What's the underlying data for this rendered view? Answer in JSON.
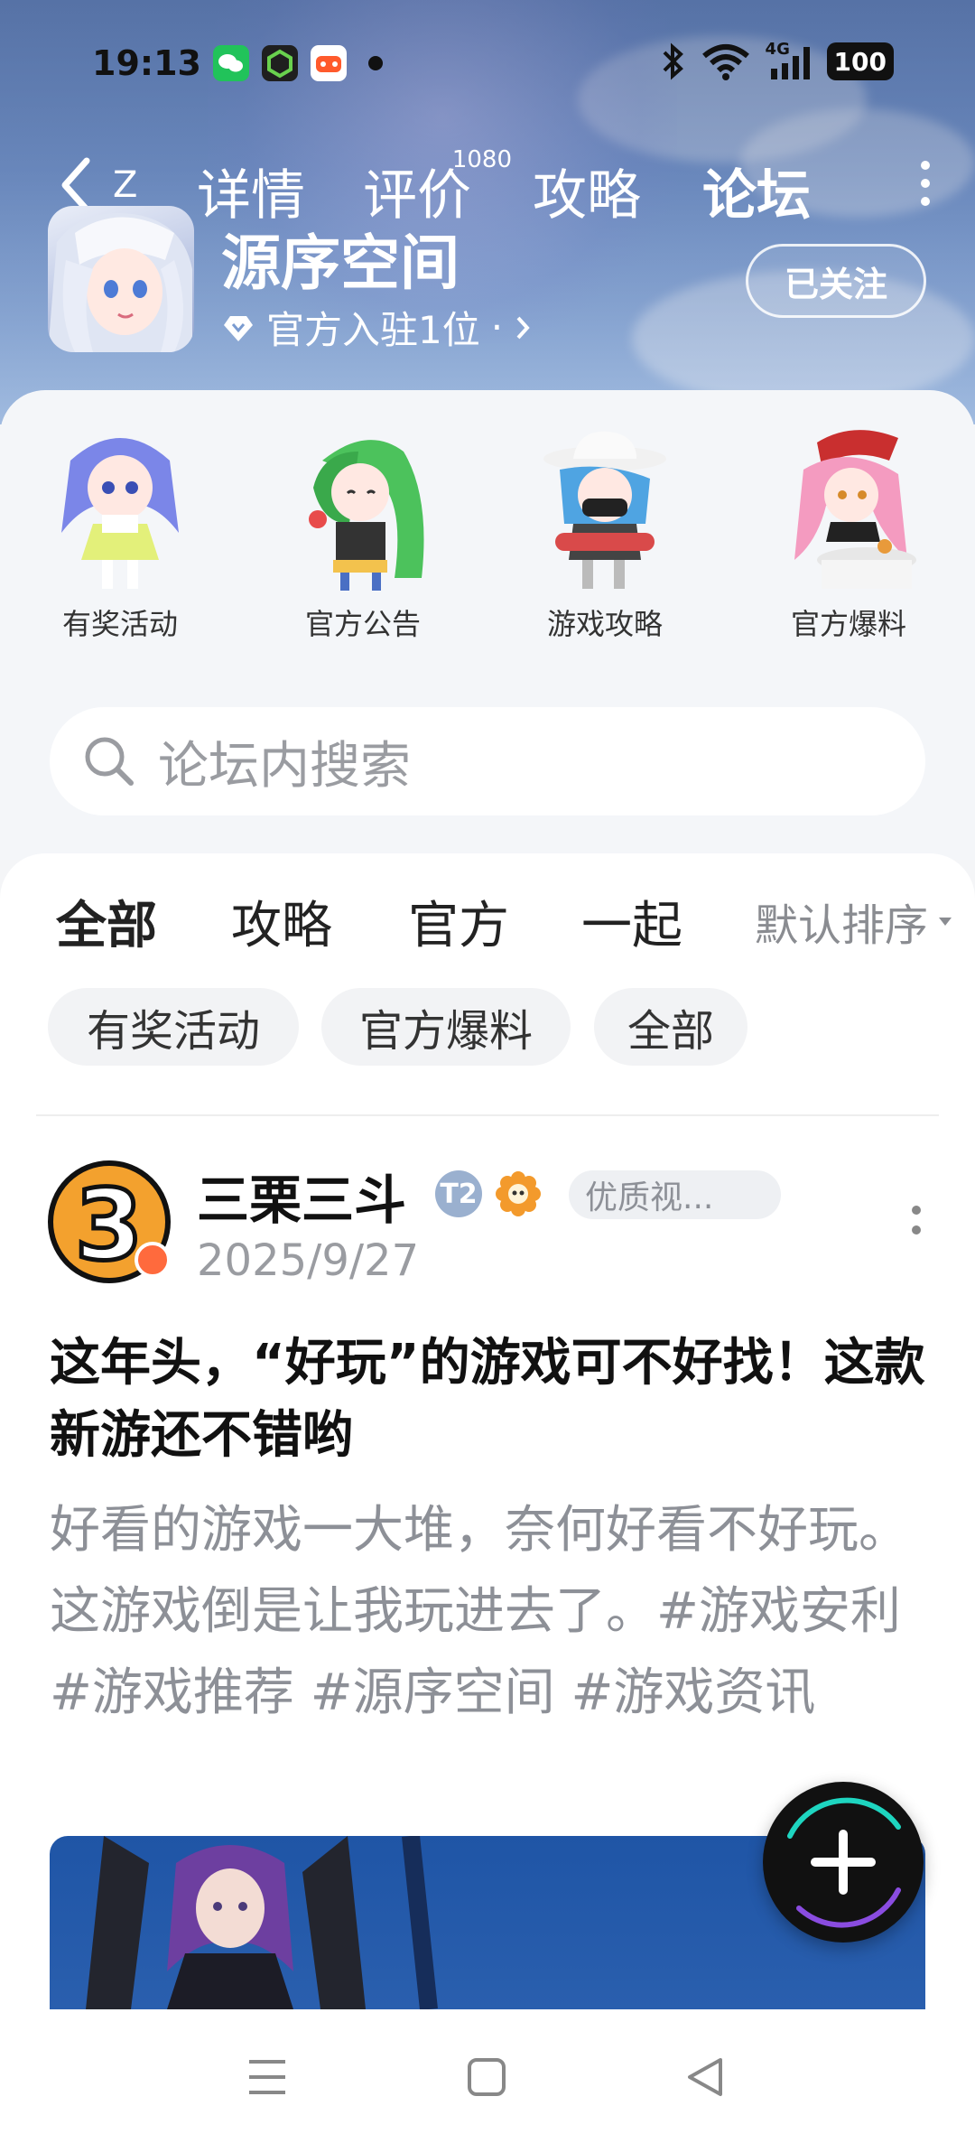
{
  "status_bar": {
    "time": "19:13",
    "network": "4G",
    "battery": "100"
  },
  "nav": {
    "tabs": [
      {
        "label": "详情"
      },
      {
        "label": "评价",
        "count": "1080"
      },
      {
        "label": "攻略"
      },
      {
        "label": "论坛"
      }
    ],
    "active_tab": "论坛"
  },
  "game": {
    "title": "源序空间",
    "official": "官方入驻1位",
    "official_suffix": "·",
    "follow_label": "已关注"
  },
  "categories": [
    {
      "label": "有奖活动"
    },
    {
      "label": "官方公告"
    },
    {
      "label": "游戏攻略"
    },
    {
      "label": "官方爆料"
    }
  ],
  "search": {
    "placeholder": "论坛内搜索"
  },
  "feed": {
    "tabs": [
      "全部",
      "攻略",
      "官方",
      "一起"
    ],
    "sort_label": "默认排序",
    "chips": [
      "有奖活动",
      "官方爆料",
      "全部"
    ]
  },
  "post": {
    "avatar_text": "3",
    "author": "三栗三斗",
    "level": "T2",
    "tag": "优质视...",
    "date": "2025/9/27",
    "title": "这年头，“好玩”的游戏可不好找！这款新游还不错哟",
    "body": "好看的游戏一大堆，奈何好看不好玩。这游戏倒是让我玩进去了。#游戏安利 #游戏推荐 #源序空间 #游戏资讯"
  },
  "colors": {
    "accent": "#1ed5c0",
    "header_bg": "#7a9bd0"
  },
  "icons": {
    "back": "chevron-left-icon",
    "more": "more-vertical-icon",
    "search": "search-icon",
    "fab": "plus-icon"
  }
}
